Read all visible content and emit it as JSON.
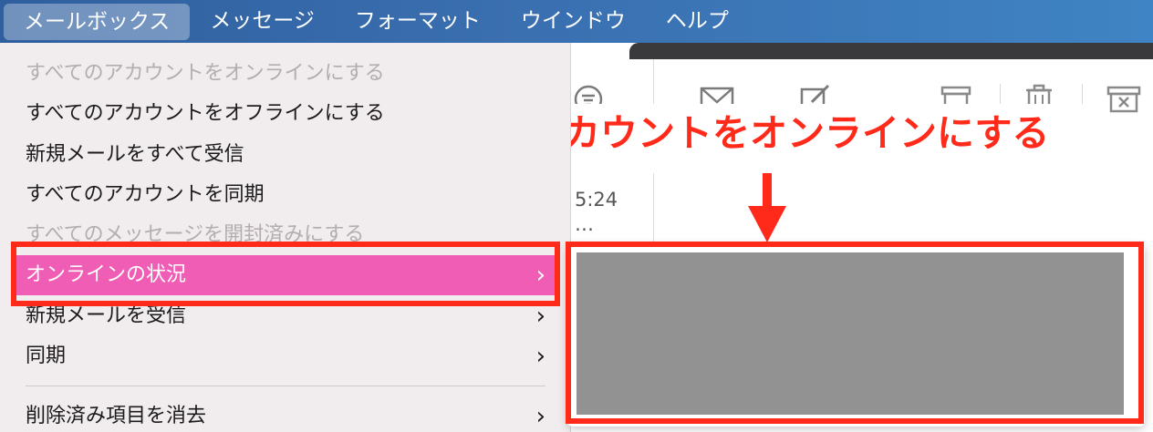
{
  "menubar": {
    "items": [
      {
        "label": "メールボックス",
        "active": true
      },
      {
        "label": "メッセージ",
        "active": false
      },
      {
        "label": "フォーマット",
        "active": false
      },
      {
        "label": "ウインドウ",
        "active": false
      },
      {
        "label": "ヘルプ",
        "active": false
      }
    ]
  },
  "dropdown": {
    "items": [
      {
        "label": "すべてのアカウントをオンラインにする",
        "state": "disabled",
        "submenu": false
      },
      {
        "label": "すべてのアカウントをオフラインにする",
        "state": "enabled",
        "submenu": false
      },
      {
        "label": "新規メールをすべて受信",
        "state": "enabled",
        "submenu": false
      },
      {
        "label": "すべてのアカウントを同期",
        "state": "enabled",
        "submenu": false
      },
      {
        "label": "すべてのメッセージを開封済みにする",
        "state": "disabled",
        "submenu": false
      },
      {
        "label": "オンラインの状況",
        "state": "highlighted",
        "submenu": true
      },
      {
        "label": "新規メールを受信",
        "state": "enabled",
        "submenu": true
      },
      {
        "label": "同期",
        "state": "enabled",
        "submenu": true
      },
      {
        "label": "削除済み項目を消去",
        "state": "enabled",
        "submenu": true
      }
    ],
    "chevron": "›"
  },
  "mail_list": {
    "time": "5:24",
    "ellipsis": "…"
  },
  "toolbar": {
    "icons": [
      "filter-icon",
      "envelope-icon",
      "compose-icon",
      "archive-icon",
      "trash-icon",
      "junk-icon"
    ]
  },
  "annotation": {
    "text": "当該アカウントをオンラインにする",
    "color": "#ff2a1a"
  },
  "colors": {
    "menubar": "#3a6fb0",
    "highlight": "#ef5db4",
    "annotation": "#ff2a1a",
    "redacted": "#929292"
  }
}
